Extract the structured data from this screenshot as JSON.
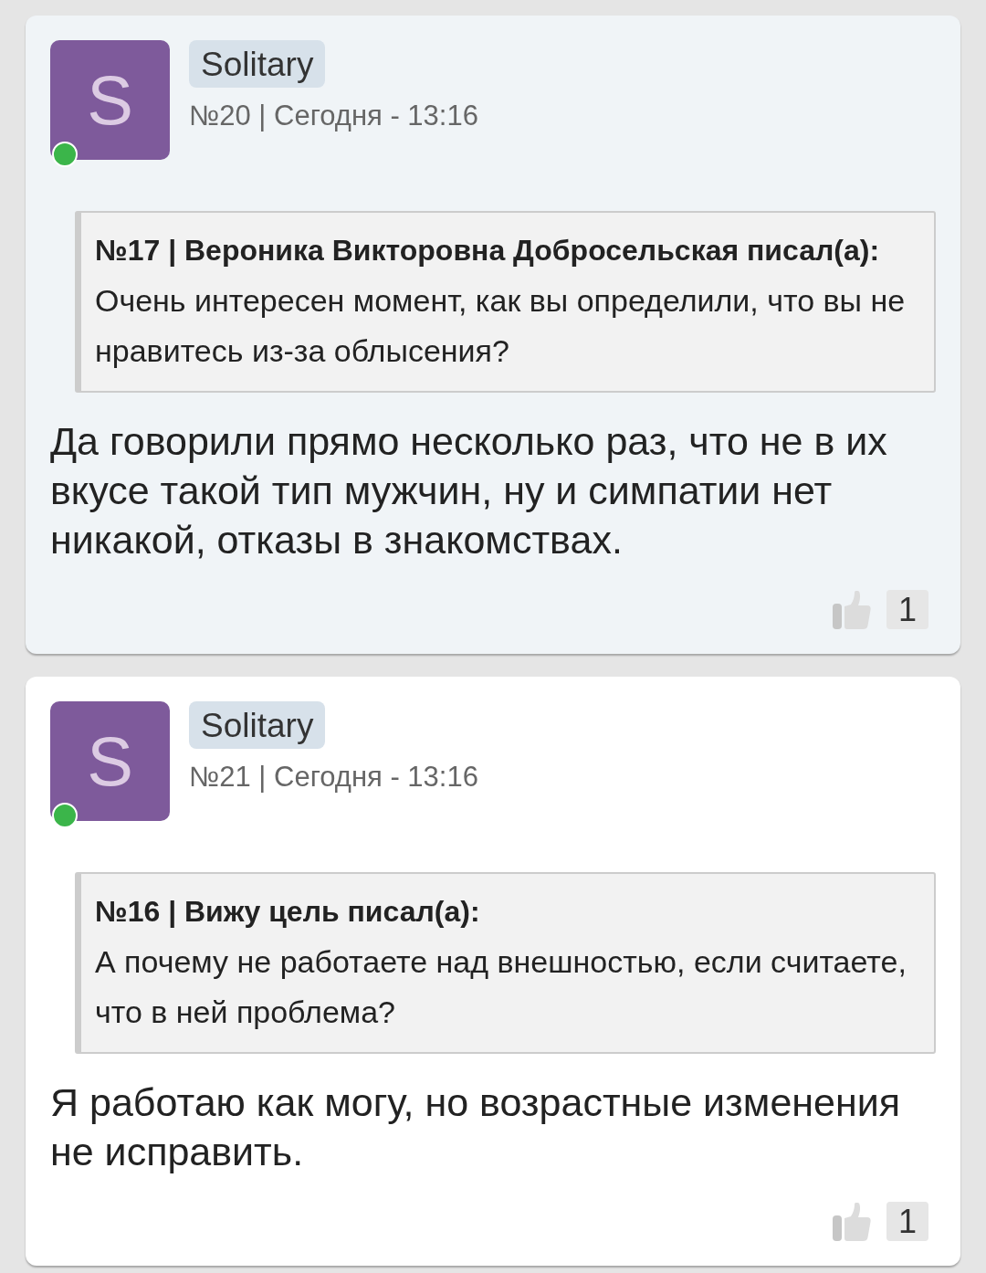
{
  "posts": [
    {
      "highlighted": true,
      "avatar_letter": "S",
      "online": true,
      "author": "Solitary",
      "meta": "№20 | Сегодня - 13:16",
      "quote": {
        "heading": "№17 | Вероника Викторовна Добросельская писал(а):",
        "text": "Очень интересен момент, как вы определили, что вы не нравитесь из-за облысения?"
      },
      "text": "Да говорили прямо несколько раз, что не в их вкусе такой тип мужчин, ну и симпатии нет никакой, отказы в знакомствах.",
      "likes": "1"
    },
    {
      "highlighted": false,
      "avatar_letter": "S",
      "online": true,
      "author": "Solitary",
      "meta": "№21 | Сегодня - 13:16",
      "quote": {
        "heading": "№16 | Вижу цель писал(а):",
        "text": "А почему не работаете над внешностью, если считаете, что в ней проблема?"
      },
      "text": "Я работаю как могу, но возрастные изменения не исправить.",
      "likes": "1"
    }
  ]
}
